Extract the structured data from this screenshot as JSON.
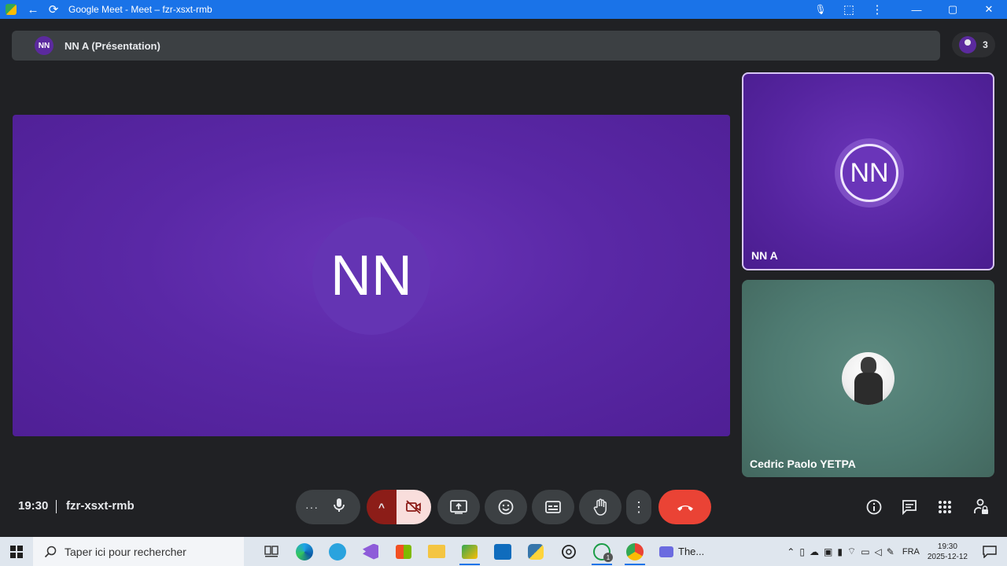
{
  "window": {
    "title": "Google Meet - Meet – fzr-xsxt-rmb",
    "back_icon": "←",
    "reload_icon": "⟳",
    "mic_icon": "🎙",
    "extension_icon": "⬚",
    "menu_icon": "⋮",
    "minimize": "—",
    "maximize": "▢",
    "close": "✕"
  },
  "presentation": {
    "avatar_initials": "NN",
    "label": "NN A (Présentation)"
  },
  "participants": {
    "count": "3"
  },
  "stage": {
    "initials": "NN",
    "background_color": "#5a28a6"
  },
  "tiles": [
    {
      "name": "NN A",
      "initials": "NN",
      "highlighted": true
    },
    {
      "name": "Cedric Paolo YETPA",
      "has_photo": true
    }
  ],
  "meeting": {
    "time": "19:30",
    "code": "fzr-xsxt-rmb"
  },
  "controls": {
    "more_options_dots": "···",
    "mic_icon": "mic-icon",
    "camera_chevron": "^",
    "camera_off_icon": "camera-off-icon",
    "present_icon": "present-screen-icon",
    "emoji_icon": "emoji-icon",
    "captions_icon": "captions-icon",
    "raise_hand_icon": "raise-hand-icon",
    "more_icon": "⋮",
    "end_call_icon": "end-call-icon",
    "end_call_color": "#ea4335",
    "camera_off_bg": "#f9dedc"
  },
  "right_panel": {
    "info_icon": "ⓘ",
    "chat_icon": "chat-icon",
    "activities_icon": "apps-grid-icon",
    "host_controls_icon": "lock-person-icon"
  },
  "taskbar": {
    "search_placeholder": "Taper ici pour rechercher",
    "running_task": "The...",
    "whatsapp_badge": "1",
    "language": "FRA",
    "time": "19:30",
    "date": "2025-12-12"
  }
}
